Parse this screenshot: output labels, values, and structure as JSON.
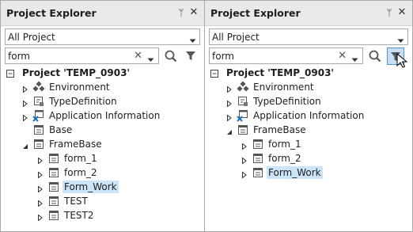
{
  "panels": [
    {
      "title": "Project Explorer",
      "pin_glyph": "ᛘ",
      "close_glyph": "✕",
      "filter_select": {
        "value": "All Project"
      },
      "search": {
        "value": "form"
      },
      "filter_active": false,
      "tree": [
        {
          "label": "Project 'TEMP_0903'",
          "icon": "project-icon",
          "expander": "collapse",
          "level": 0,
          "bold": true
        },
        {
          "label": "Environment",
          "icon": "environment-icon",
          "expander": "expand",
          "level": 1
        },
        {
          "label": "TypeDefinition",
          "icon": "type-definition-icon",
          "expander": "expand",
          "level": 1
        },
        {
          "label": "Application Information",
          "icon": "application-info-icon",
          "expander": "expand",
          "level": 1
        },
        {
          "label": "Base",
          "icon": "form-icon",
          "expander": "none",
          "level": 1
        },
        {
          "label": "FrameBase",
          "icon": "form-icon",
          "expander": "expanded",
          "level": 1
        },
        {
          "label": "form_1",
          "icon": "form-icon",
          "expander": "expand",
          "level": 2
        },
        {
          "label": "form_2",
          "icon": "form-icon",
          "expander": "expand",
          "level": 2
        },
        {
          "label": "Form_Work",
          "icon": "form-icon",
          "expander": "expand",
          "level": 2,
          "selected": true
        },
        {
          "label": "TEST",
          "icon": "form-icon",
          "expander": "expand",
          "level": 2
        },
        {
          "label": "TEST2",
          "icon": "form-icon",
          "expander": "expand",
          "level": 2
        }
      ]
    },
    {
      "title": "Project Explorer",
      "pin_glyph": "ᛘ",
      "close_glyph": "✕",
      "filter_select": {
        "value": "All Project"
      },
      "search": {
        "value": "form"
      },
      "filter_active": true,
      "tree": [
        {
          "label": "Project 'TEMP_0903'",
          "icon": "project-icon",
          "expander": "collapse",
          "level": 0,
          "bold": true
        },
        {
          "label": "Environment",
          "icon": "environment-icon",
          "expander": "expand",
          "level": 1
        },
        {
          "label": "TypeDefinition",
          "icon": "type-definition-icon",
          "expander": "expand",
          "level": 1
        },
        {
          "label": "Application Information",
          "icon": "application-info-icon",
          "expander": "expand",
          "level": 1
        },
        {
          "label": "FrameBase",
          "icon": "form-icon",
          "expander": "expanded",
          "level": 1
        },
        {
          "label": "form_1",
          "icon": "form-icon",
          "expander": "expand",
          "level": 2
        },
        {
          "label": "form_2",
          "icon": "form-icon",
          "expander": "expand",
          "level": 2
        },
        {
          "label": "Form_Work",
          "icon": "form-icon",
          "expander": "expand",
          "level": 2,
          "selected": true
        }
      ]
    }
  ],
  "colors": {
    "selection": "#cce4f7",
    "active_tool_bg": "#c7def4",
    "active_tool_border": "#4c96d7",
    "titlebar": "#e9e9e9"
  }
}
